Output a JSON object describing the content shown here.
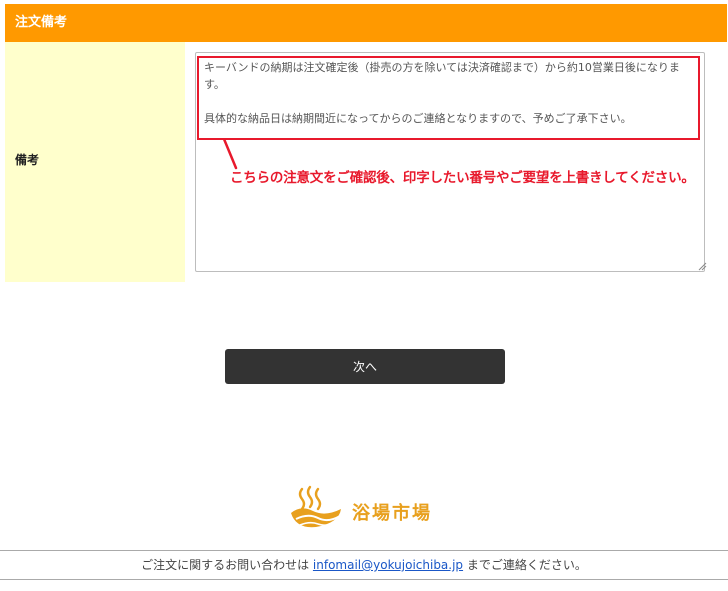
{
  "section": {
    "title": "注文備考"
  },
  "form": {
    "label": "備考",
    "textarea_value": "キーバンドの納期は注文確定後（掛売の方を除いては決済確認まで）から約10営業日後になります。\n\n具体的な納品日は納期間近になってからのご連絡となりますので、予めご了承下さい。"
  },
  "annotation": {
    "callout": "こちらの注意文をご確認後、印字したい番号やご要望を上書きしてください。",
    "color": "#e8192c"
  },
  "actions": {
    "next_label": "次へ"
  },
  "logo": {
    "text": "浴場市場",
    "color": "#e8a01e"
  },
  "footer": {
    "text_before": "ご注文に関するお問い合わせは ",
    "email": "infomail@yokujoichiba.jp",
    "text_after": " までご連絡ください。"
  },
  "colors": {
    "header": "#ff9900",
    "label_bg": "#ffffcc",
    "button": "#333333"
  }
}
